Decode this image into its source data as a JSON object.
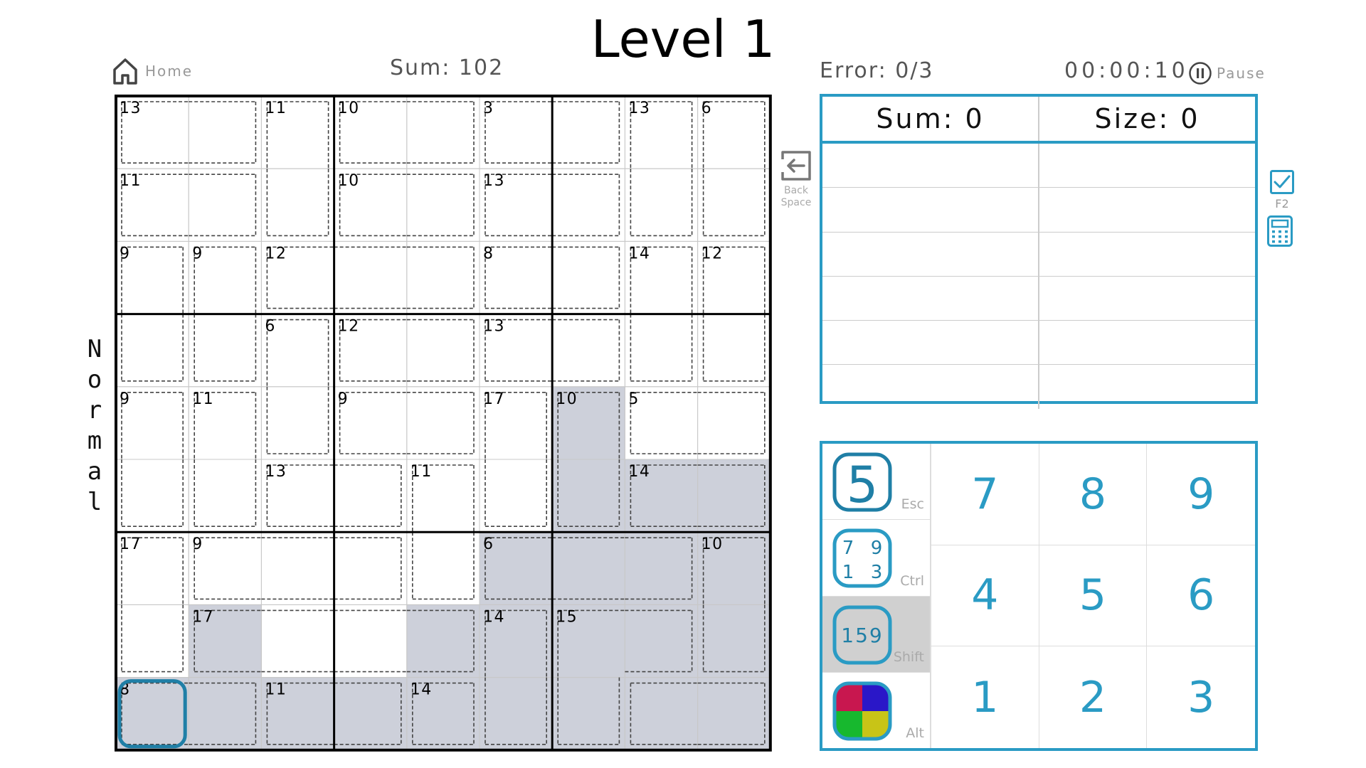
{
  "title": "Level 1",
  "header": {
    "home_label": "Home",
    "sum_text": "Sum: 102",
    "error_text": "Error: 0/3",
    "timer": "00:00:10",
    "pause_label": "Pause"
  },
  "mode_label": [
    "N",
    "o",
    "r",
    "m",
    "a",
    "l"
  ],
  "board": {
    "cages": [
      {
        "sum": 13,
        "cells": [
          [
            0,
            0
          ],
          [
            0,
            1
          ]
        ]
      },
      {
        "sum": 11,
        "cells": [
          [
            0,
            2
          ],
          [
            1,
            2
          ]
        ]
      },
      {
        "sum": 10,
        "cells": [
          [
            0,
            3
          ],
          [
            0,
            4
          ]
        ]
      },
      {
        "sum": 3,
        "cells": [
          [
            0,
            5
          ],
          [
            0,
            6
          ]
        ]
      },
      {
        "sum": 13,
        "cells": [
          [
            0,
            7
          ],
          [
            1,
            7
          ]
        ]
      },
      {
        "sum": 6,
        "cells": [
          [
            0,
            8
          ],
          [
            1,
            8
          ]
        ]
      },
      {
        "sum": 11,
        "cells": [
          [
            1,
            0
          ],
          [
            1,
            1
          ]
        ]
      },
      {
        "sum": 10,
        "cells": [
          [
            1,
            3
          ],
          [
            1,
            4
          ]
        ]
      },
      {
        "sum": 13,
        "cells": [
          [
            1,
            5
          ],
          [
            1,
            6
          ]
        ]
      },
      {
        "sum": 9,
        "cells": [
          [
            2,
            0
          ],
          [
            3,
            0
          ]
        ]
      },
      {
        "sum": 9,
        "cells": [
          [
            2,
            1
          ],
          [
            3,
            1
          ]
        ]
      },
      {
        "sum": 12,
        "cells": [
          [
            2,
            2
          ],
          [
            2,
            3
          ],
          [
            2,
            4
          ]
        ]
      },
      {
        "sum": 8,
        "cells": [
          [
            2,
            5
          ],
          [
            2,
            6
          ]
        ]
      },
      {
        "sum": 14,
        "cells": [
          [
            2,
            7
          ],
          [
            3,
            7
          ]
        ]
      },
      {
        "sum": 12,
        "cells": [
          [
            2,
            8
          ],
          [
            3,
            8
          ]
        ]
      },
      {
        "sum": 6,
        "cells": [
          [
            3,
            2
          ],
          [
            4,
            2
          ]
        ]
      },
      {
        "sum": 12,
        "cells": [
          [
            3,
            3
          ],
          [
            3,
            4
          ]
        ]
      },
      {
        "sum": 13,
        "cells": [
          [
            3,
            5
          ],
          [
            3,
            6
          ]
        ]
      },
      {
        "sum": 9,
        "cells": [
          [
            4,
            0
          ],
          [
            5,
            0
          ]
        ]
      },
      {
        "sum": 11,
        "cells": [
          [
            4,
            1
          ],
          [
            5,
            1
          ]
        ]
      },
      {
        "sum": 9,
        "cells": [
          [
            4,
            3
          ],
          [
            4,
            4
          ]
        ]
      },
      {
        "sum": 17,
        "cells": [
          [
            4,
            5
          ],
          [
            5,
            5
          ]
        ]
      },
      {
        "sum": 10,
        "cells": [
          [
            4,
            6
          ],
          [
            5,
            6
          ]
        ]
      },
      {
        "sum": 5,
        "cells": [
          [
            4,
            7
          ],
          [
            4,
            8
          ]
        ]
      },
      {
        "sum": 13,
        "cells": [
          [
            5,
            2
          ],
          [
            5,
            3
          ]
        ]
      },
      {
        "sum": 11,
        "cells": [
          [
            5,
            4
          ],
          [
            6,
            4
          ]
        ]
      },
      {
        "sum": 14,
        "cells": [
          [
            5,
            7
          ],
          [
            5,
            8
          ]
        ]
      },
      {
        "sum": 17,
        "cells": [
          [
            6,
            0
          ],
          [
            7,
            0
          ]
        ]
      },
      {
        "sum": 9,
        "cells": [
          [
            6,
            1
          ],
          [
            6,
            2
          ],
          [
            6,
            3
          ]
        ]
      },
      {
        "sum": 6,
        "cells": [
          [
            6,
            5
          ],
          [
            6,
            6
          ],
          [
            6,
            7
          ]
        ]
      },
      {
        "sum": 10,
        "cells": [
          [
            6,
            8
          ],
          [
            7,
            8
          ]
        ]
      },
      {
        "sum": 17,
        "cells": [
          [
            7,
            1
          ],
          [
            7,
            2
          ],
          [
            7,
            3
          ],
          [
            7,
            4
          ]
        ]
      },
      {
        "sum": 14,
        "cells": [
          [
            7,
            5
          ],
          [
            8,
            5
          ]
        ]
      },
      {
        "sum": 15,
        "cells": [
          [
            7,
            6
          ],
          [
            7,
            7
          ],
          [
            8,
            6
          ]
        ]
      },
      {
        "sum": 8,
        "cells": [
          [
            8,
            0
          ],
          [
            8,
            1
          ]
        ]
      },
      {
        "sum": 11,
        "cells": [
          [
            8,
            2
          ],
          [
            8,
            3
          ]
        ]
      },
      {
        "sum": 14,
        "cells": [
          [
            8,
            4
          ],
          [
            8,
            7
          ],
          [
            8,
            8
          ]
        ]
      }
    ],
    "shaded": [
      [
        4,
        6
      ],
      [
        5,
        6
      ],
      [
        5,
        7
      ],
      [
        5,
        8
      ],
      [
        6,
        5
      ],
      [
        6,
        6
      ],
      [
        6,
        7
      ],
      [
        6,
        8
      ],
      [
        7,
        1
      ],
      [
        7,
        5
      ],
      [
        7,
        6
      ],
      [
        7,
        7
      ],
      [
        7,
        8
      ],
      [
        8,
        0
      ],
      [
        8,
        1
      ],
      [
        8,
        2
      ],
      [
        8,
        3
      ],
      [
        8,
        4
      ],
      [
        8,
        5
      ],
      [
        8,
        6
      ],
      [
        8,
        7
      ],
      [
        8,
        8
      ],
      [
        7,
        4
      ]
    ],
    "selected": [
      8,
      0
    ],
    "colors": {
      "shade": "#cdd0da",
      "accent": "#1f7fa6",
      "cage_line": "#444444",
      "thin": "#c8c8c8"
    }
  },
  "backspace": {
    "icon": "backspace-icon",
    "line1": "Back",
    "line2": "Space"
  },
  "calc_panel": {
    "sum_label": "Sum: 0",
    "size_label": "Size: 0",
    "rows": [
      [
        "",
        ""
      ],
      [
        "",
        ""
      ],
      [
        "",
        ""
      ],
      [
        "",
        ""
      ],
      [
        "",
        ""
      ],
      [
        "",
        ""
      ]
    ]
  },
  "side_buttons": {
    "check_icon": "checkbox-icon",
    "check_key": "F2",
    "calculator_icon": "calculator-icon"
  },
  "modes": [
    {
      "key": "Esc",
      "icon": "big-digit-5",
      "digit": "5"
    },
    {
      "key": "Ctrl",
      "icon": "corner-notes",
      "digits": [
        "7",
        "9",
        "1",
        "3"
      ]
    },
    {
      "key": "Shift",
      "icon": "center-notes",
      "text": "159"
    },
    {
      "key": "Alt",
      "icon": "color-palette",
      "colors": [
        "#c8174f",
        "#2a17c8",
        "#17b82e",
        "#c8c417"
      ]
    }
  ],
  "numpad": [
    "7",
    "8",
    "9",
    "4",
    "5",
    "6",
    "1",
    "2",
    "3"
  ],
  "accent_color": "#2a9bc4"
}
